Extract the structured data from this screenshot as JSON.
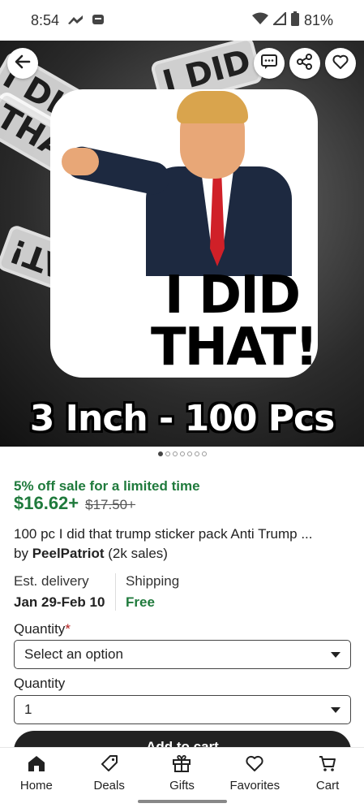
{
  "status": {
    "time": "8:54",
    "battery": "81%"
  },
  "hero": {
    "bg_texts": [
      "I DID",
      "THAT!",
      "I DID",
      "THAT!"
    ],
    "slogan_line1": "I DID",
    "slogan_line2": "THAT!",
    "caption": "3 Inch - 100 Pcs",
    "carousel_count": 7,
    "carousel_active": 0
  },
  "icons": {
    "back": "arrow-left-icon",
    "message": "message-icon",
    "share": "share-icon",
    "favorite": "heart-icon"
  },
  "product": {
    "sale_text": "5% off sale for a limited time",
    "price": "$16.62+",
    "original_price": "$17.50+",
    "title": "100 pc I did that trump sticker pack Anti Trump ...",
    "by": "by",
    "seller": "PeelPatriot",
    "sales": "(2k sales)"
  },
  "delivery": {
    "label": "Est. delivery",
    "value": "Jan 29-Feb 10"
  },
  "shipping": {
    "label": "Shipping",
    "value": "Free"
  },
  "quantity_required": {
    "label": "Quantity",
    "required_mark": "*",
    "value": "Select an option"
  },
  "quantity": {
    "label": "Quantity",
    "value": "1"
  },
  "add_to_cart": "Add to cart",
  "nav": [
    {
      "label": "Home",
      "icon": "home-icon"
    },
    {
      "label": "Deals",
      "icon": "tag-icon"
    },
    {
      "label": "Gifts",
      "icon": "gift-icon"
    },
    {
      "label": "Favorites",
      "icon": "heart-icon"
    },
    {
      "label": "Cart",
      "icon": "cart-icon"
    }
  ],
  "colors": {
    "accent_green": "#1f7a3c",
    "dark": "#222222"
  }
}
